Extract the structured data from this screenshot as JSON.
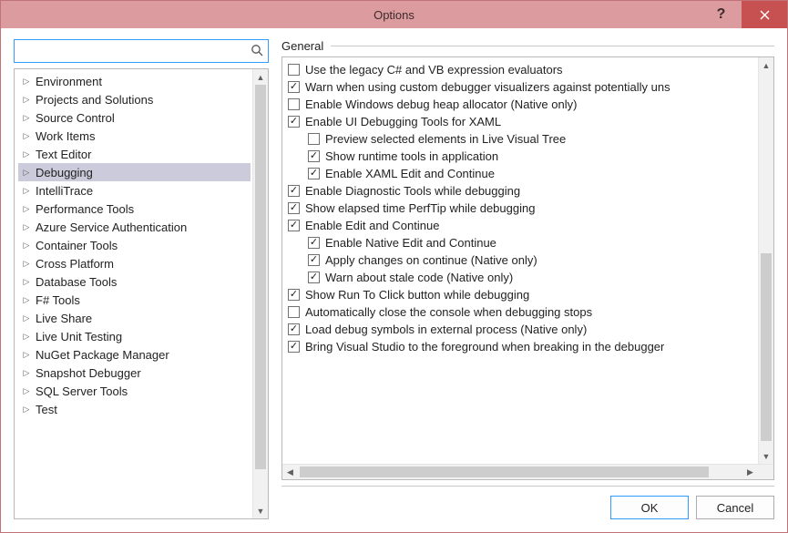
{
  "window": {
    "title": "Options"
  },
  "search": {
    "placeholder": ""
  },
  "tree": {
    "items": [
      {
        "label": "Environment"
      },
      {
        "label": "Projects and Solutions"
      },
      {
        "label": "Source Control"
      },
      {
        "label": "Work Items"
      },
      {
        "label": "Text Editor"
      },
      {
        "label": "Debugging",
        "selected": true
      },
      {
        "label": "IntelliTrace"
      },
      {
        "label": "Performance Tools"
      },
      {
        "label": "Azure Service Authentication"
      },
      {
        "label": "Container Tools"
      },
      {
        "label": "Cross Platform"
      },
      {
        "label": "Database Tools"
      },
      {
        "label": "F# Tools"
      },
      {
        "label": "Live Share"
      },
      {
        "label": "Live Unit Testing"
      },
      {
        "label": "NuGet Package Manager"
      },
      {
        "label": "Snapshot Debugger"
      },
      {
        "label": "SQL Server Tools"
      },
      {
        "label": "Test"
      }
    ]
  },
  "section": {
    "title": "General"
  },
  "options": [
    {
      "label": "Use the legacy C# and VB expression evaluators",
      "checked": false,
      "indent": 0
    },
    {
      "label": "Warn when using custom debugger visualizers against potentially uns",
      "checked": true,
      "indent": 0
    },
    {
      "label": "Enable Windows debug heap allocator (Native only)",
      "checked": false,
      "indent": 0
    },
    {
      "label": "Enable UI Debugging Tools for XAML",
      "checked": true,
      "indent": 0
    },
    {
      "label": "Preview selected elements in Live Visual Tree",
      "checked": false,
      "indent": 1
    },
    {
      "label": "Show runtime tools in application",
      "checked": true,
      "indent": 1
    },
    {
      "label": "Enable XAML Edit and Continue",
      "checked": true,
      "indent": 1
    },
    {
      "label": "Enable Diagnostic Tools while debugging",
      "checked": true,
      "indent": 0
    },
    {
      "label": "Show elapsed time PerfTip while debugging",
      "checked": true,
      "indent": 0
    },
    {
      "label": "Enable Edit and Continue",
      "checked": true,
      "indent": 0
    },
    {
      "label": "Enable Native Edit and Continue",
      "checked": true,
      "indent": 1
    },
    {
      "label": "Apply changes on continue (Native only)",
      "checked": true,
      "indent": 1
    },
    {
      "label": "Warn about stale code (Native only)",
      "checked": true,
      "indent": 1
    },
    {
      "label": "Show Run To Click button while debugging",
      "checked": true,
      "indent": 0
    },
    {
      "label": "Automatically close the console when debugging stops",
      "checked": false,
      "indent": 0
    },
    {
      "label": "Load debug symbols in external process (Native only)",
      "checked": true,
      "indent": 0
    },
    {
      "label": "Bring Visual Studio to the foreground when breaking in the debugger",
      "checked": true,
      "indent": 0
    }
  ],
  "buttons": {
    "ok": "OK",
    "cancel": "Cancel"
  }
}
